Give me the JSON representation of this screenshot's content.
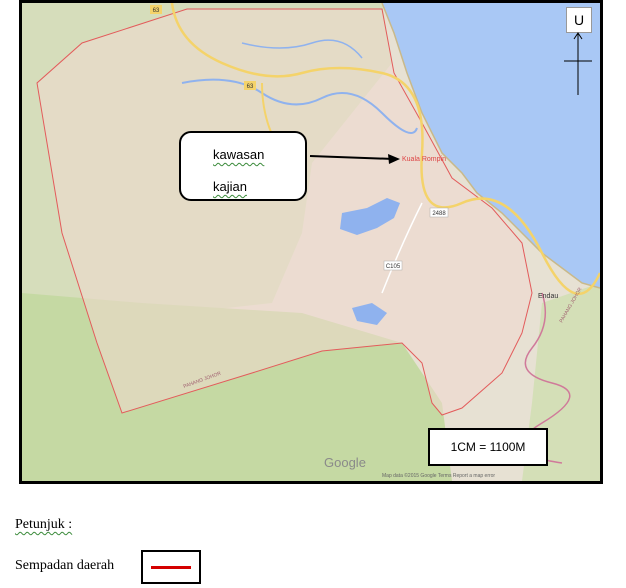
{
  "map": {
    "compass_label": "U",
    "callout_line1": "kawasan",
    "callout_line2": "kajian",
    "scale": "1CM = 1100M",
    "watermark": "Google",
    "attribution": "Map data ©2015 Google   Terms   Report a map error",
    "place_labels": {
      "kuala_rompin": "Kuala Rompin",
      "endau": "Endau",
      "route_63_top": "63",
      "route_63_mid": "63",
      "route_2488": "2488",
      "route_c105": "C105",
      "state_pahang_johor_1": "PAHANG\nJOHOR",
      "state_pahang_johor_2": "PAHANG\nJOHOR"
    },
    "colors": {
      "sea": "#a9c8f5",
      "land": "#e8e2d5",
      "forest": "#c6d9a6",
      "boundary": "#e35b5b",
      "road": "#f4d36a"
    }
  },
  "legend": {
    "title": "Petunjuk :",
    "item_label": "Sempadan daerah",
    "item_color": "#d40000"
  }
}
